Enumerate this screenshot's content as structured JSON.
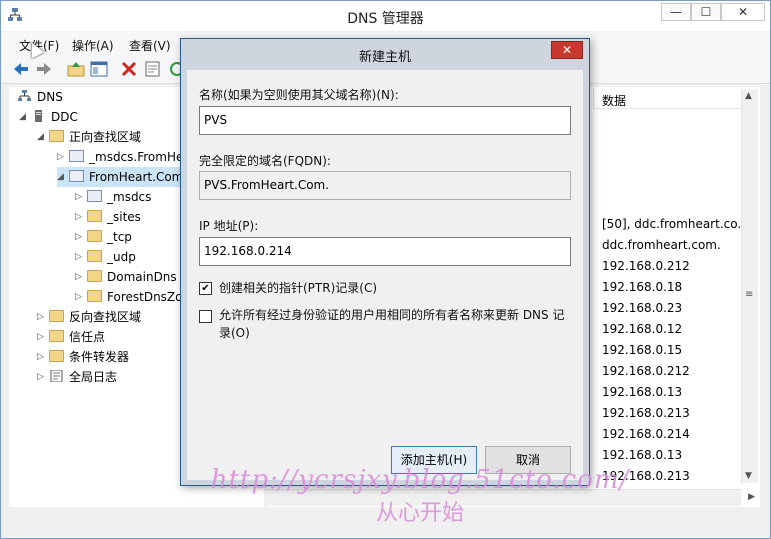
{
  "window": {
    "title": "DNS 管理器",
    "controls": {
      "minimize": "—",
      "maximize": "☐",
      "close": "✕"
    }
  },
  "menu": [
    "文件(F)",
    "操作(A)",
    "查看(V)"
  ],
  "tree": {
    "root": "DNS",
    "server": "DDC",
    "forward_zones": "正向查找区域",
    "msdcs_zone": "_msdcs.FromHe",
    "zone": "FromHeart.Com",
    "zone_children": [
      "_msdcs",
      "_sites",
      "_tcp",
      "_udp",
      "DomainDns",
      "ForestDnsZo"
    ],
    "reverse_zones": "反向查找区域",
    "trust_points": "信任点",
    "conditional_forwarders": "条件转发器",
    "global_logs": "全局日志"
  },
  "right_pane": {
    "column_header": "数据",
    "rows": [
      "[50], ddc.fromheart.co...",
      "ddc.fromheart.com.",
      "192.168.0.212",
      "192.168.0.18",
      "192.168.0.23",
      "192.168.0.12",
      "192.168.0.15",
      "192.168.0.212",
      "192.168.0.13",
      "192.168.0.213",
      "192.168.0.214",
      "192.168.0.13",
      "192.168.0.213"
    ]
  },
  "dialog": {
    "title": "新建主机",
    "close": "✕",
    "name_label": "名称(如果为空则使用其父域名称)(N):",
    "name_value": "PVS",
    "fqdn_label": "完全限定的域名(FQDN):",
    "fqdn_value": "PVS.FromHeart.Com.",
    "ip_label": "IP 地址(P):",
    "ip_value": "192.168.0.214",
    "ptr_label": "创建相关的指针(PTR)记录(C)",
    "ptr_checked": true,
    "allow_label": "允许所有经过身份验证的用户用相同的所有者名称来更新 DNS 记录(O)",
    "allow_checked": false,
    "add_button": "添加主机(H)",
    "cancel_button": "取消"
  },
  "watermark": {
    "line1": "http://ycrsjxy.blog.51cto.com/",
    "line2": "从心开始"
  }
}
